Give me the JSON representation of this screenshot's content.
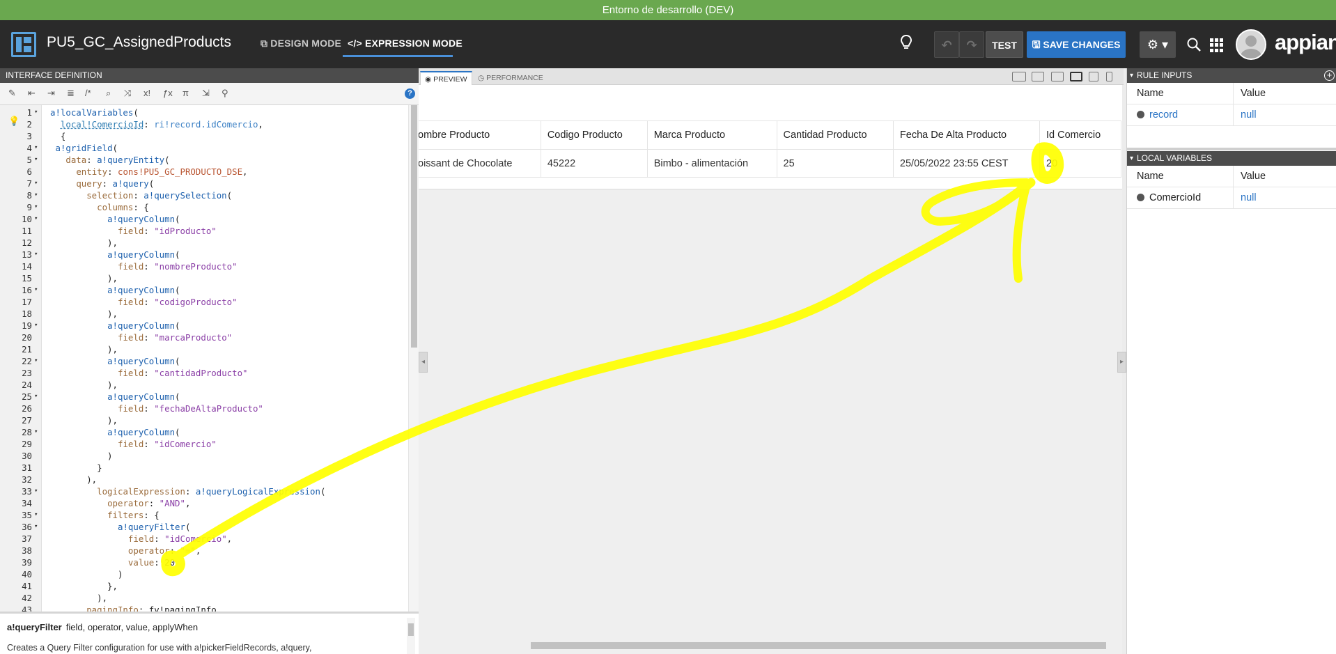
{
  "environment": {
    "banner": "Entorno de desarrollo (DEV)"
  },
  "header": {
    "title": "PU5_GC_AssignedProducts",
    "modes": {
      "design": "DESIGN MODE",
      "expression": "EXPRESSION MODE"
    },
    "buttons": {
      "undo": "↶",
      "redo": "↷",
      "test": "TEST",
      "save": "SAVE CHANGES",
      "gear": "⚙ ▾"
    },
    "logo": "appian"
  },
  "left": {
    "header": "INTERFACE DEFINITION",
    "code_lines": [
      {
        "n": "1",
        "fold": "▾",
        "text": "a!localVariables("
      },
      {
        "n": "2",
        "fold": "",
        "text": "  local!ComercioId: ri!record.idComercio,"
      },
      {
        "n": "3",
        "fold": "",
        "text": "  {"
      },
      {
        "n": "4",
        "fold": "▾",
        "text": " a!gridField("
      },
      {
        "n": "5",
        "fold": "▾",
        "text": "   data: a!queryEntity("
      },
      {
        "n": "6",
        "fold": "",
        "text": "     entity: cons!PU5_GC_PRODUCTO_DSE,"
      },
      {
        "n": "7",
        "fold": "▾",
        "text": "     query: a!query("
      },
      {
        "n": "8",
        "fold": "▾",
        "text": "       selection: a!querySelection("
      },
      {
        "n": "9",
        "fold": "▾",
        "text": "         columns: {"
      },
      {
        "n": "10",
        "fold": "▾",
        "text": "           a!queryColumn("
      },
      {
        "n": "11",
        "fold": "",
        "text": "             field: \"idProducto\""
      },
      {
        "n": "12",
        "fold": "",
        "text": "           ),"
      },
      {
        "n": "13",
        "fold": "▾",
        "text": "           a!queryColumn("
      },
      {
        "n": "14",
        "fold": "",
        "text": "             field: \"nombreProducto\""
      },
      {
        "n": "15",
        "fold": "",
        "text": "           ),"
      },
      {
        "n": "16",
        "fold": "▾",
        "text": "           a!queryColumn("
      },
      {
        "n": "17",
        "fold": "",
        "text": "             field: \"codigoProducto\""
      },
      {
        "n": "18",
        "fold": "",
        "text": "           ),"
      },
      {
        "n": "19",
        "fold": "▾",
        "text": "           a!queryColumn("
      },
      {
        "n": "20",
        "fold": "",
        "text": "             field: \"marcaProducto\""
      },
      {
        "n": "21",
        "fold": "",
        "text": "           ),"
      },
      {
        "n": "22",
        "fold": "▾",
        "text": "           a!queryColumn("
      },
      {
        "n": "23",
        "fold": "",
        "text": "             field: \"cantidadProducto\""
      },
      {
        "n": "24",
        "fold": "",
        "text": "           ),"
      },
      {
        "n": "25",
        "fold": "▾",
        "text": "           a!queryColumn("
      },
      {
        "n": "26",
        "fold": "",
        "text": "             field: \"fechaDeAltaProducto\""
      },
      {
        "n": "27",
        "fold": "",
        "text": "           ),"
      },
      {
        "n": "28",
        "fold": "▾",
        "text": "           a!queryColumn("
      },
      {
        "n": "29",
        "fold": "",
        "text": "             field: \"idComercio\""
      },
      {
        "n": "30",
        "fold": "",
        "text": "           )"
      },
      {
        "n": "31",
        "fold": "",
        "text": "         }"
      },
      {
        "n": "32",
        "fold": "",
        "text": "       ),"
      },
      {
        "n": "33",
        "fold": "▾",
        "text": "         logicalExpression: a!queryLogicalExpression("
      },
      {
        "n": "34",
        "fold": "",
        "text": "           operator: \"AND\","
      },
      {
        "n": "35",
        "fold": "▾",
        "text": "           filters: {"
      },
      {
        "n": "36",
        "fold": "▾",
        "text": "             a!queryFilter("
      },
      {
        "n": "37",
        "fold": "",
        "text": "               field: \"idComercio\","
      },
      {
        "n": "38",
        "fold": "",
        "text": "               operator: \"=\","
      },
      {
        "n": "39",
        "fold": "",
        "text": "               value: 20"
      },
      {
        "n": "40",
        "fold": "",
        "text": "             )"
      },
      {
        "n": "41",
        "fold": "",
        "text": "           },"
      },
      {
        "n": "42",
        "fold": "",
        "text": "         ),"
      },
      {
        "n": "43",
        "fold": "",
        "text": "       pagingInfo: fv!pagingInfo"
      }
    ],
    "doc": {
      "function": "a!queryFilter",
      "params": "field, operator, value, applyWhen",
      "description": "Creates a Query Filter configuration for use with a!pickerFieldRecords, a!query,"
    }
  },
  "center": {
    "tabs": {
      "preview": "PREVIEW",
      "performance": "PERFORMANCE"
    },
    "grid": {
      "headers": [
        "ombre Producto",
        "Codigo Producto",
        "Marca Producto",
        "Cantidad Producto",
        "Fecha De Alta Producto",
        "Id Comercio"
      ],
      "rows": [
        [
          "oissant de Chocolate",
          "45222",
          "Bimbo - alimentación",
          "25",
          "25/05/2022 23:55 CEST",
          "20"
        ]
      ]
    }
  },
  "right": {
    "rule_inputs": {
      "header": "RULE INPUTS",
      "col_name": "Name",
      "col_value": "Value",
      "items": [
        {
          "name": "record",
          "value": "null"
        }
      ]
    },
    "local_variables": {
      "header": "LOCAL VARIABLES",
      "col_name": "Name",
      "col_value": "Value",
      "items": [
        {
          "name": "ComercioId",
          "value": "null"
        }
      ]
    }
  },
  "colors": {
    "env_banner": "#6aa84f",
    "topbar": "#2a2a2a",
    "accent": "#2a74c5",
    "annotation": "#ffff00"
  }
}
